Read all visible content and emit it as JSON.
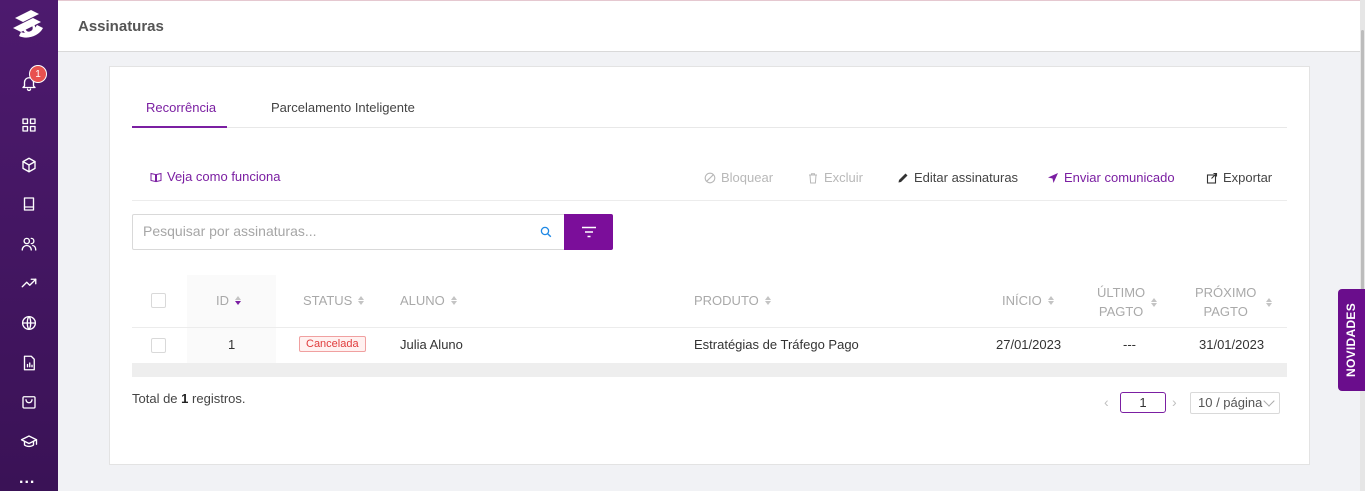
{
  "header": {
    "title": "Assinaturas"
  },
  "sidebar": {
    "notification_count": "1",
    "more": "..."
  },
  "tabs": [
    {
      "label": "Recorrência",
      "active": true
    },
    {
      "label": "Parcelamento Inteligente",
      "active": false
    }
  ],
  "toolbar": {
    "help_link": "Veja como funciona",
    "block": "Bloquear",
    "delete": "Excluir",
    "edit": "Editar assinaturas",
    "send": "Enviar comunicado",
    "export": "Exportar"
  },
  "search": {
    "placeholder": "Pesquisar por assinaturas..."
  },
  "table": {
    "columns": {
      "id": "ID",
      "status": "STATUS",
      "student": "ALUNO",
      "product": "PRODUTO",
      "start": "INÍCIO",
      "last_paid_1": "ÚLTIMO",
      "last_paid_2": "PAGTO",
      "next_paid_1": "PRÓXIMO",
      "next_paid_2": "PAGTO"
    },
    "rows": [
      {
        "id": "1",
        "status": "Cancelada",
        "student": "Julia Aluno",
        "product": "Estratégias de Tráfego Pago",
        "start": "27/01/2023",
        "last_paid": "---",
        "next_paid": "31/01/2023"
      }
    ]
  },
  "footer": {
    "total_prefix": "Total de",
    "total_count": "1",
    "total_suffix": "registros.",
    "current_page": "1",
    "page_size": "10 / página"
  },
  "side_tab": {
    "label": "NOVIDADES"
  },
  "colors": {
    "primary": "#7b1fa2",
    "sidebar": "#4d1a6e",
    "danger": "#e03c3c"
  }
}
